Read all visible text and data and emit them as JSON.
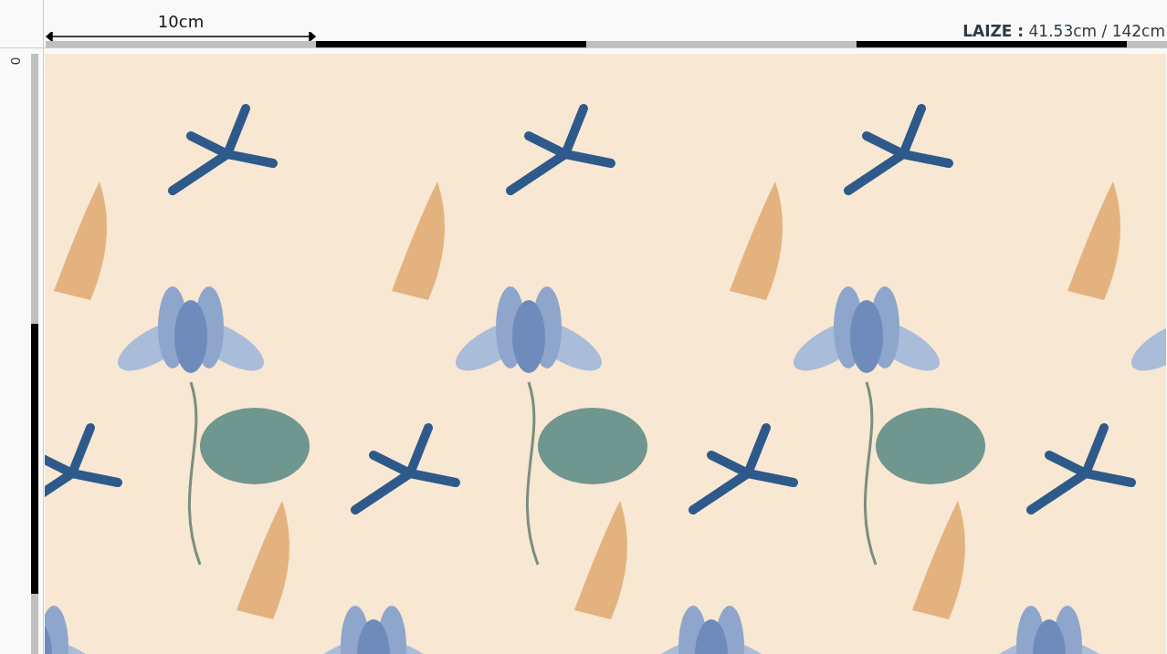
{
  "top_ruler": {
    "scale_label": "10cm",
    "width_label": "LAIZE :",
    "width_value": "41.53cm / 142cm"
  },
  "left_ruler": {
    "scale_label": "0"
  }
}
